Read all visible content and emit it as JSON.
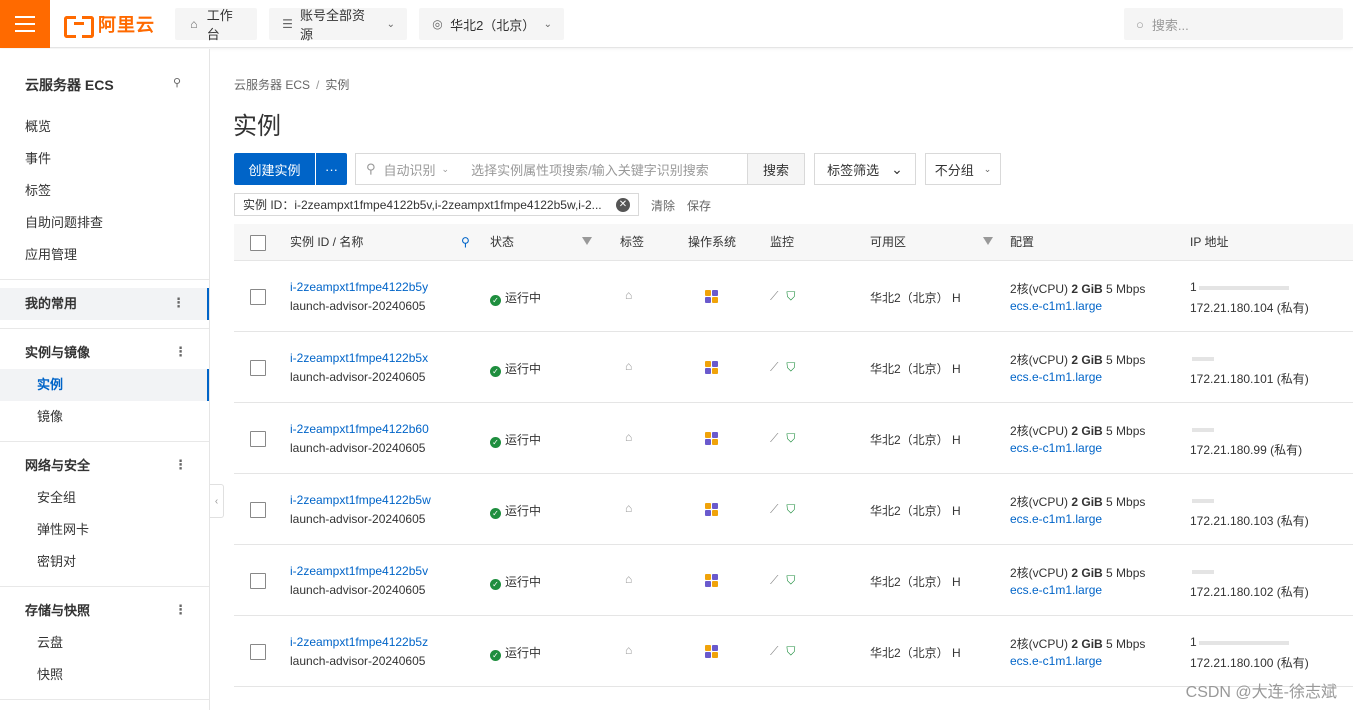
{
  "topbar": {
    "logo_text": "阿里云",
    "workbench": "工作台",
    "resources": "账号全部资源",
    "region": "华北2（北京）",
    "search_placeholder": "搜索..."
  },
  "sidebar": {
    "title": "云服务器 ECS",
    "items": [
      "概览",
      "事件",
      "标签",
      "自助问题排查",
      "应用管理"
    ],
    "favorites": "我的常用",
    "group_instances": "实例与镜像",
    "instances": "实例",
    "images": "镜像",
    "group_network": "网络与安全",
    "security_group": "安全组",
    "eni": "弹性网卡",
    "keypair": "密钥对",
    "group_storage": "存储与快照",
    "disk": "云盘",
    "snapshot": "快照"
  },
  "main": {
    "breadcrumb_root": "云服务器 ECS",
    "breadcrumb_sep": "/",
    "breadcrumb_current": "实例",
    "title": "实例",
    "create_btn": "创建实例",
    "more_btn": "···",
    "search_mode": "自动识别",
    "search_placeholder": "选择实例属性项搜索/输入关键字识别搜索",
    "search_btn": "搜索",
    "tag_filter": "标签筛选",
    "group_select": "不分组",
    "chip_key": "实例 ID：",
    "chip_value": "i-2zeampxt1fmpe4122b5v,i-2zeampxt1fmpe4122b5w,i-2...",
    "clear": "清除",
    "save": "保存"
  },
  "table": {
    "headers": {
      "id": "实例 ID / 名称",
      "status": "状态",
      "tag": "标签",
      "os": "操作系统",
      "monitor": "监控",
      "zone": "可用区",
      "config": "配置",
      "ip": "IP 地址"
    },
    "rows": [
      {
        "id": "i-2zeampxt1fmpe4122b5y",
        "name": "launch-advisor-20240605",
        "status": "运行中",
        "zone": "华北2（北京） H",
        "config_cpu": "2核(vCPU)",
        "config_mem": "2 GiB",
        "config_bw": "5 Mbps",
        "spec": "ecs.e-c1m1.large",
        "public_ip_fragment": "1",
        "private_ip": "172.21.180.104 (私有)"
      },
      {
        "id": "i-2zeampxt1fmpe4122b5x",
        "name": "launch-advisor-20240605",
        "status": "运行中",
        "zone": "华北2（北京） H",
        "config_cpu": "2核(vCPU)",
        "config_mem": "2 GiB",
        "config_bw": "5 Mbps",
        "spec": "ecs.e-c1m1.large",
        "public_ip_fragment": "",
        "private_ip": "172.21.180.101 (私有)"
      },
      {
        "id": "i-2zeampxt1fmpe4122b60",
        "name": "launch-advisor-20240605",
        "status": "运行中",
        "zone": "华北2（北京） H",
        "config_cpu": "2核(vCPU)",
        "config_mem": "2 GiB",
        "config_bw": "5 Mbps",
        "spec": "ecs.e-c1m1.large",
        "public_ip_fragment": "",
        "private_ip": "172.21.180.99 (私有)"
      },
      {
        "id": "i-2zeampxt1fmpe4122b5w",
        "name": "launch-advisor-20240605",
        "status": "运行中",
        "zone": "华北2（北京） H",
        "config_cpu": "2核(vCPU)",
        "config_mem": "2 GiB",
        "config_bw": "5 Mbps",
        "spec": "ecs.e-c1m1.large",
        "public_ip_fragment": "",
        "private_ip": "172.21.180.103 (私有)"
      },
      {
        "id": "i-2zeampxt1fmpe4122b5v",
        "name": "launch-advisor-20240605",
        "status": "运行中",
        "zone": "华北2（北京） H",
        "config_cpu": "2核(vCPU)",
        "config_mem": "2 GiB",
        "config_bw": "5 Mbps",
        "spec": "ecs.e-c1m1.large",
        "public_ip_fragment": "",
        "private_ip": "172.21.180.102 (私有)"
      },
      {
        "id": "i-2zeampxt1fmpe4122b5z",
        "name": "launch-advisor-20240605",
        "status": "运行中",
        "zone": "华北2（北京） H",
        "config_cpu": "2核(vCPU)",
        "config_mem": "2 GiB",
        "config_bw": "5 Mbps",
        "spec": "ecs.e-c1m1.large",
        "public_ip_fragment": "1",
        "private_ip": "172.21.180.100 (私有)"
      }
    ]
  },
  "watermark": "CSDN @大连-徐志斌",
  "colors": {
    "brand": "#ff6a00",
    "primary": "#0064c8",
    "running": "#1e8e3e"
  }
}
